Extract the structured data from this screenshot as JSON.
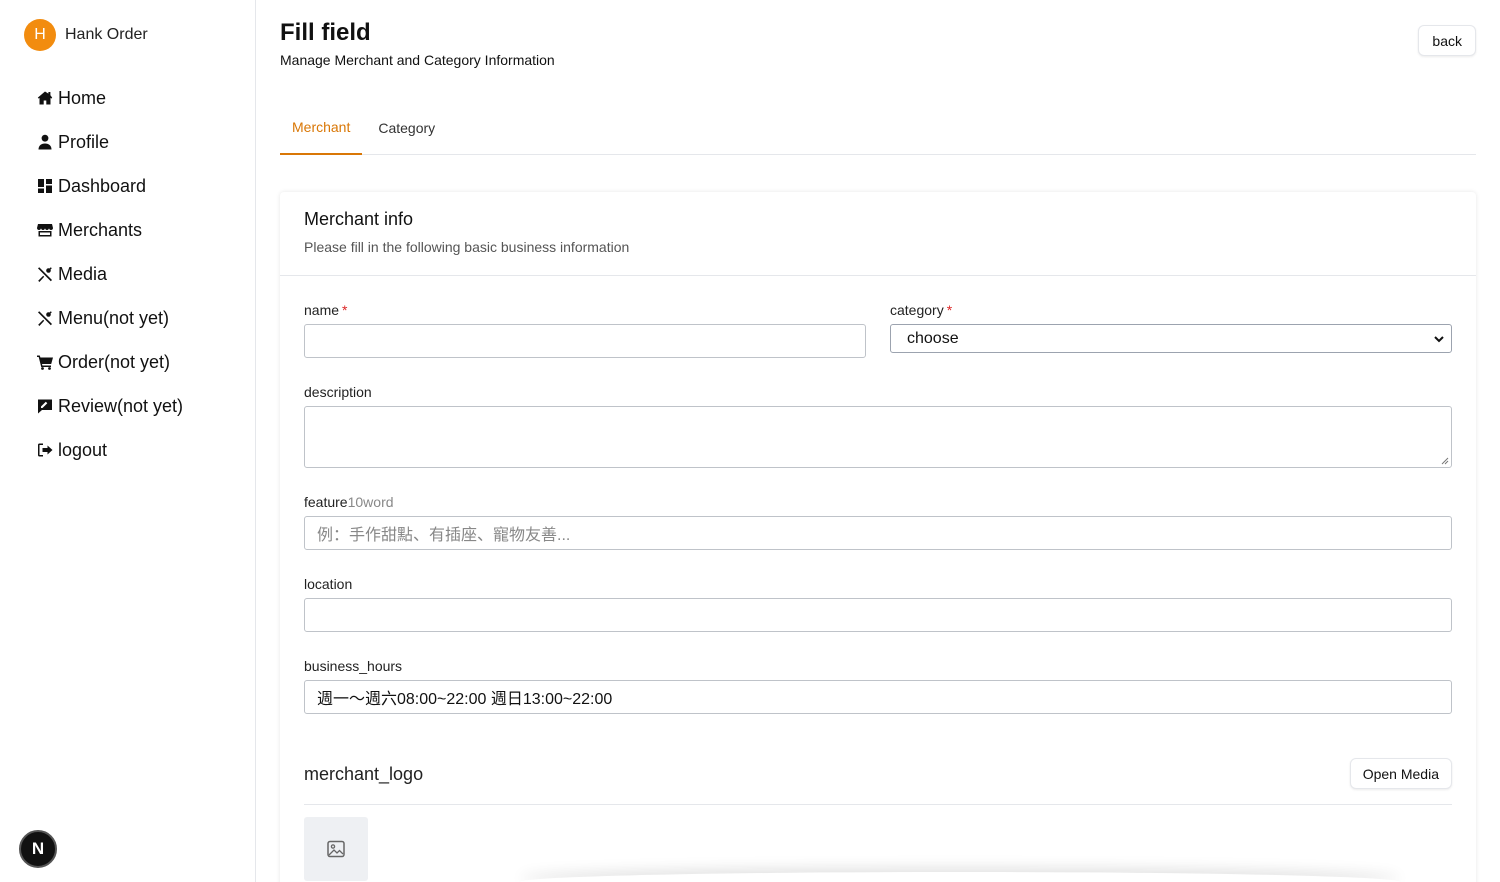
{
  "brand": {
    "avatar_letter": "H",
    "name": "Hank Order",
    "accent": "#f28c0f"
  },
  "sidebar": {
    "items": [
      {
        "label": "Home",
        "icon": "home-icon"
      },
      {
        "label": "Profile",
        "icon": "user-icon"
      },
      {
        "label": "Dashboard",
        "icon": "dashboard-icon"
      },
      {
        "label": "Merchants",
        "icon": "store-icon"
      },
      {
        "label": "Media",
        "icon": "utensils-icon"
      },
      {
        "label": "Menu(not yet)",
        "icon": "utensils-icon"
      },
      {
        "label": "Order(not yet)",
        "icon": "cart-icon"
      },
      {
        "label": "Review(not yet)",
        "icon": "review-icon"
      },
      {
        "label": "logout",
        "icon": "logout-icon"
      }
    ]
  },
  "header": {
    "title": "Fill field",
    "subtitle": "Manage Merchant and Category Information",
    "back_label": "back"
  },
  "tabs": [
    {
      "label": "Merchant",
      "active": true
    },
    {
      "label": "Category",
      "active": false
    }
  ],
  "tab_accent": "#d97706",
  "card": {
    "title": "Merchant info",
    "description": "Please fill in the following basic business information"
  },
  "form": {
    "name": {
      "label": "name",
      "required_mark": "*",
      "value": ""
    },
    "category": {
      "label": "category",
      "required_mark": "*",
      "selected": "choose"
    },
    "description": {
      "label": "description",
      "value": ""
    },
    "feature": {
      "label": "feature",
      "hint": "10word",
      "placeholder": "例：手作甜點、有插座、寵物友善..."
    },
    "location": {
      "label": "location",
      "value": ""
    },
    "business_hours": {
      "label": "business_hours",
      "value": "週一～週六08:00~22:00 週日13:00~22:00"
    }
  },
  "logo_section": {
    "title": "merchant_logo",
    "open_media_label": "Open Media",
    "placeholder_icon": "image-icon"
  },
  "dev_badge": {
    "letter": "N",
    "icon": "nextjs-icon"
  }
}
